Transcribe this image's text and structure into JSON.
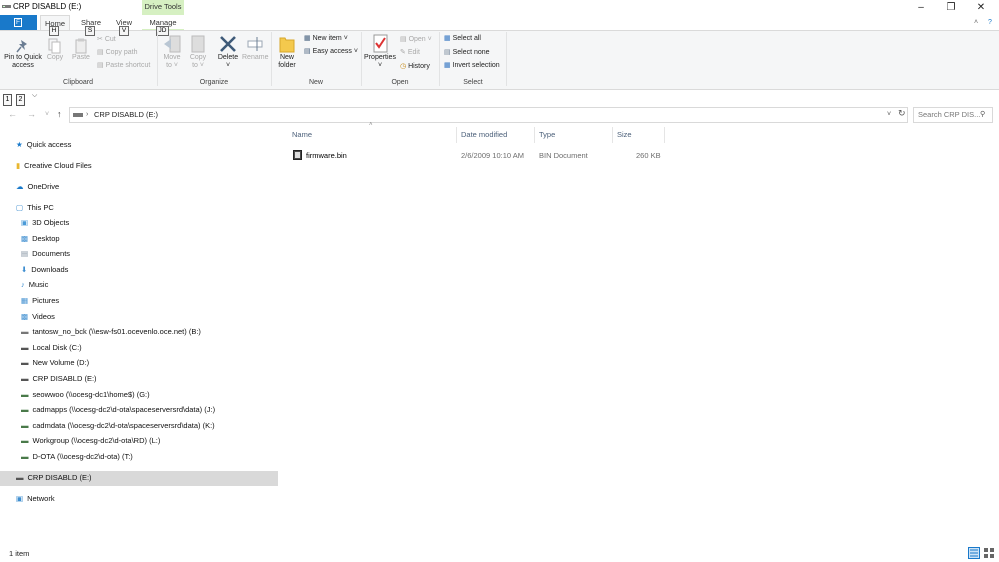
{
  "window": {
    "title": "CRP DISABLD (E:)",
    "contextual_tab": "Drive Tools"
  },
  "tabs": {
    "file_key": "F",
    "home": "Home",
    "home_key": "H",
    "share": "Share",
    "share_key": "S",
    "view": "View",
    "view_key": "V",
    "manage": "Manage",
    "manage_key": "JD"
  },
  "ribbon": {
    "clipboard": {
      "label": "Clipboard",
      "pin_line1": "Pin to Quick",
      "pin_line2": "access",
      "copy": "Copy",
      "paste": "Paste",
      "cut": "Cut",
      "copy_path": "Copy path",
      "paste_shortcut": "Paste shortcut"
    },
    "organize": {
      "label": "Organize",
      "move_line1": "Move",
      "move_line2": "to ˅",
      "copy_line1": "Copy",
      "copy_line2": "to ˅",
      "delete": "Delete",
      "rename": "Rename"
    },
    "new": {
      "label": "New",
      "folder_line1": "New",
      "folder_line2": "folder",
      "new_item": "New item ˅",
      "easy_access": "Easy access ˅"
    },
    "open": {
      "label": "Open",
      "properties": "Properties",
      "open": "Open ˅",
      "edit": "Edit",
      "history": "History"
    },
    "select": {
      "label": "Select",
      "select_all": "Select all",
      "select_none": "Select none",
      "invert": "Invert selection"
    }
  },
  "qat": {
    "key1": "1",
    "key2": "2"
  },
  "address": {
    "path": "CRP DISABLD (E:)",
    "search_placeholder": "Search CRP DIS..."
  },
  "nav": {
    "quick_access": "Quick access",
    "creative_cloud": "Creative Cloud Files",
    "onedrive": "OneDrive",
    "this_pc": "This PC",
    "objects3d": "3D Objects",
    "desktop": "Desktop",
    "documents": "Documents",
    "downloads": "Downloads",
    "music": "Music",
    "pictures": "Pictures",
    "videos": "Videos",
    "drive_b": "tantosw_no_bck (\\\\esw-fs01.ocevenlo.oce.net) (B:)",
    "drive_c": "Local Disk (C:)",
    "drive_d": "New Volume (D:)",
    "drive_e": "CRP DISABLD (E:)",
    "drive_g": "seowwoo (\\\\ocesg-dc1\\home$) (G:)",
    "drive_j": "cadmapps (\\\\ocesg-dc2\\d-ota\\spaceserversrd\\data) (J:)",
    "drive_k": "cadmdata (\\\\ocesg-dc2\\d-ota\\spaceserversrd\\data) (K:)",
    "drive_l": "Workgroup (\\\\ocesg-dc2\\d-ota\\RD) (L:)",
    "drive_t": "D-OTA (\\\\ocesg-dc2\\d-ota) (T:)",
    "selected_drive": "CRP DISABLD (E:)",
    "network": "Network"
  },
  "columns": {
    "name": "Name",
    "date": "Date modified",
    "type": "Type",
    "size": "Size"
  },
  "files": [
    {
      "name": "firmware.bin",
      "date": "2/6/2009 10:10 AM",
      "type": "BIN Document",
      "size": "260 KB"
    }
  ],
  "status": {
    "count": "1 item"
  }
}
